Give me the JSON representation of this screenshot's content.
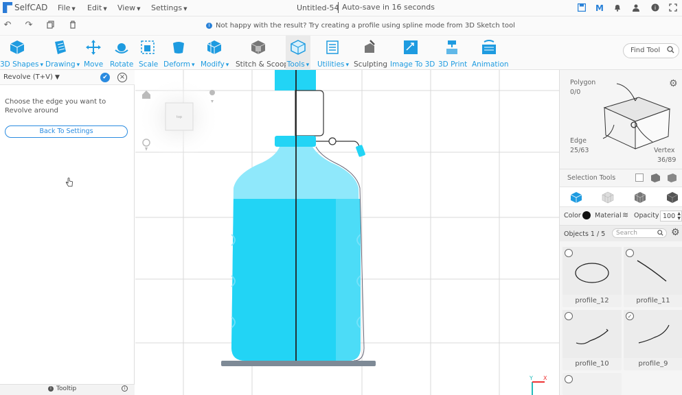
{
  "app": {
    "name": "SelfCAD",
    "doc_title": "Untitled-54",
    "autosave": "Auto-save in 16 seconds"
  },
  "menus": [
    "File",
    "Edit",
    "View",
    "Settings"
  ],
  "info_message": "Not happy with the result? Try creating a profile using spline mode from 3D Sketch tool",
  "toolbar": [
    {
      "label": "3D Shapes",
      "dropdown": true,
      "color": "blue",
      "icon": "cube-icon"
    },
    {
      "label": "Drawing",
      "dropdown": true,
      "color": "blue",
      "icon": "drawing-icon"
    },
    {
      "label": "Move",
      "dropdown": false,
      "color": "blue",
      "icon": "move-icon"
    },
    {
      "label": "Rotate",
      "dropdown": false,
      "color": "blue",
      "icon": "rotate-icon"
    },
    {
      "label": "Scale",
      "dropdown": false,
      "color": "blue",
      "icon": "scale-icon"
    },
    {
      "label": "Deform",
      "dropdown": true,
      "color": "blue",
      "icon": "deform-icon"
    },
    {
      "label": "Modify",
      "dropdown": true,
      "color": "blue",
      "icon": "modify-icon"
    },
    {
      "label": "Stitch & Scoop",
      "dropdown": false,
      "color": "gray",
      "icon": "stitch-scoop-icon"
    },
    {
      "label": "Tools",
      "dropdown": true,
      "color": "blue",
      "icon": "tools-icon",
      "active": true
    },
    {
      "label": "Utilities",
      "dropdown": true,
      "color": "blue",
      "icon": "utilities-icon"
    },
    {
      "label": "Sculpting",
      "dropdown": false,
      "color": "gray",
      "icon": "sculpting-icon"
    },
    {
      "label": "Image To 3D",
      "dropdown": false,
      "color": "blue",
      "icon": "image-to-3d-icon"
    },
    {
      "label": "3D Print",
      "dropdown": false,
      "color": "blue",
      "icon": "3d-print-icon"
    },
    {
      "label": "Animation",
      "dropdown": false,
      "color": "blue",
      "icon": "animation-icon"
    }
  ],
  "find_tool": {
    "placeholder": "Find Tool"
  },
  "left_panel": {
    "title": "Revolve (T+V)",
    "instruction": "Choose the edge you want to Revolve around",
    "back_button": "Back To Settings",
    "tooltip_label": "Tooltip"
  },
  "right_panel": {
    "polygon_label": "Polygon",
    "polygon_count": "0/0",
    "edge_label": "Edge",
    "edge_count": "25/63",
    "vertex_label": "Vertex",
    "vertex_count": "36/89",
    "selection_tools_label": "Selection Tools",
    "color_label": "Color",
    "material_label": "Material",
    "opacity_label": "Opacity",
    "opacity_value": "100",
    "objects_label": "Objects 1 / 5",
    "search_placeholder": "Search",
    "objects": [
      {
        "name": "profile_12",
        "checked": false,
        "shape": "ellipse"
      },
      {
        "name": "profile_11",
        "checked": false,
        "shape": "line"
      },
      {
        "name": "profile_10",
        "checked": false,
        "shape": "curve"
      },
      {
        "name": "profile_9",
        "checked": true,
        "shape": "curve2"
      }
    ]
  },
  "viewport": {
    "view_cube_face": "top",
    "axis_labels": {
      "y": "Y",
      "x": "X"
    }
  },
  "colors": {
    "accent": "#1e9be0",
    "bottle_fill": "#22d4f5",
    "bottle_light": "#8fe8fb"
  }
}
